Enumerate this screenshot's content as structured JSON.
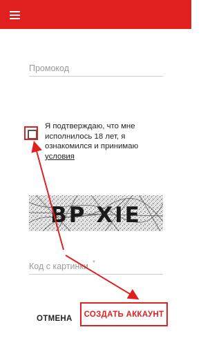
{
  "header": {
    "menu_icon": "hamburger-menu-icon"
  },
  "form": {
    "promo_placeholder": "Промокод",
    "consent_text": "Я подтверждаю, что мне исполнилось 18 лет, я ознакомился и принимаю",
    "consent_link": "условия",
    "captcha_text": "BP XIE",
    "captcha_placeholder": "Код с картинки",
    "captcha_required_mark": "*"
  },
  "actions": {
    "cancel_label": "ОТМЕНА",
    "create_label": "СОЗДАТЬ АККАУНТ"
  },
  "colors": {
    "accent": "#e0201f",
    "annotation": "#e0201f"
  }
}
